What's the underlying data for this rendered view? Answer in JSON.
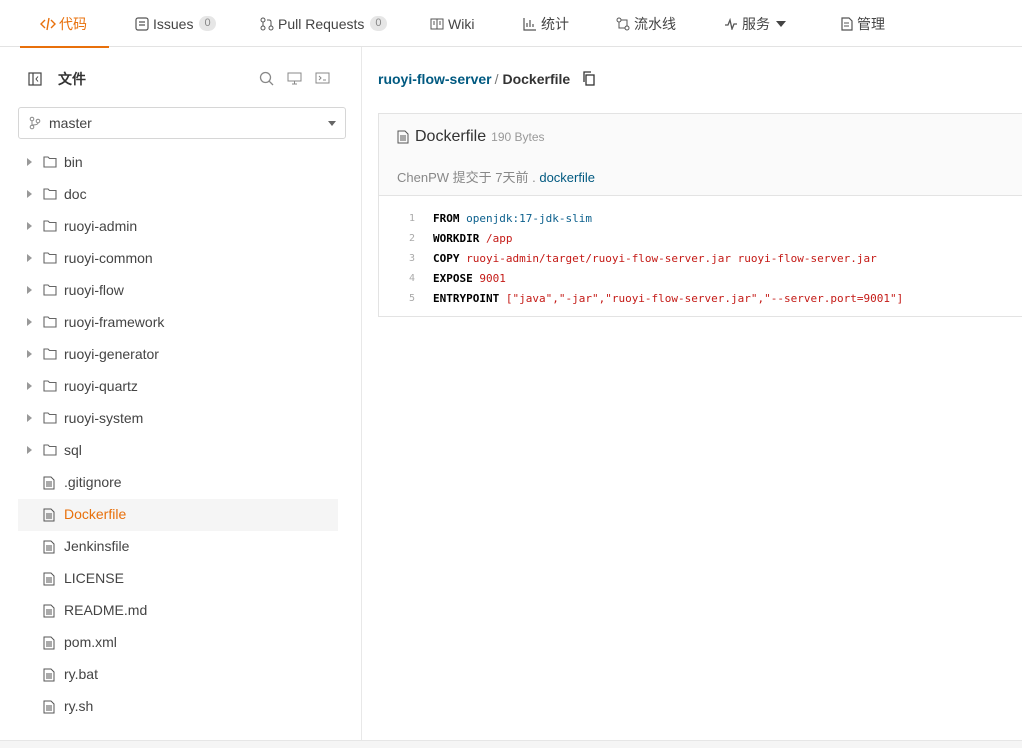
{
  "tabs": [
    {
      "label": "代码",
      "icon": "code-icon",
      "active": true
    },
    {
      "label": "Issues",
      "icon": "issues-icon",
      "badge": "0"
    },
    {
      "label": "Pull Requests",
      "icon": "pull-request-icon",
      "badge": "0"
    },
    {
      "label": "Wiki",
      "icon": "wiki-icon"
    },
    {
      "label": "统计",
      "icon": "stats-icon"
    },
    {
      "label": "流水线",
      "icon": "pipeline-icon"
    },
    {
      "label": "服务",
      "icon": "service-icon"
    },
    {
      "label": "管理",
      "icon": "manage-icon"
    }
  ],
  "sidebar": {
    "title": "文件",
    "branch": "master",
    "items": [
      {
        "label": "bin",
        "type": "folder"
      },
      {
        "label": "doc",
        "type": "folder"
      },
      {
        "label": "ruoyi-admin",
        "type": "folder"
      },
      {
        "label": "ruoyi-common",
        "type": "folder"
      },
      {
        "label": "ruoyi-flow",
        "type": "folder"
      },
      {
        "label": "ruoyi-framework",
        "type": "folder"
      },
      {
        "label": "ruoyi-generator",
        "type": "folder"
      },
      {
        "label": "ruoyi-quartz",
        "type": "folder"
      },
      {
        "label": "ruoyi-system",
        "type": "folder"
      },
      {
        "label": "sql",
        "type": "folder"
      },
      {
        "label": ".gitignore",
        "type": "file"
      },
      {
        "label": "Dockerfile",
        "type": "file",
        "selected": true
      },
      {
        "label": "Jenkinsfile",
        "type": "file"
      },
      {
        "label": "LICENSE",
        "type": "file"
      },
      {
        "label": "README.md",
        "type": "file"
      },
      {
        "label": "pom.xml",
        "type": "file"
      },
      {
        "label": "ry.bat",
        "type": "file"
      },
      {
        "label": "ry.sh",
        "type": "file"
      }
    ]
  },
  "breadcrumb": {
    "repo": "ruoyi-flow-server",
    "separator": "/",
    "file": "Dockerfile"
  },
  "file": {
    "name": "Dockerfile",
    "size": "190 Bytes",
    "commit_author": "ChenPW",
    "commit_text": " 提交于 ",
    "commit_ago": "7天前",
    "commit_dot": " . ",
    "commit_message": "dockerfile",
    "lines": [
      {
        "n": "1",
        "kw": "FROM",
        "a": "openjdk:17-jdk-slim",
        "b": ""
      },
      {
        "n": "2",
        "kw": "WORKDIR",
        "a": "",
        "b": "/app"
      },
      {
        "n": "3",
        "kw": "COPY",
        "a": "",
        "b": "ruoyi-admin/target/ruoyi-flow-server.jar ruoyi-flow-server.jar"
      },
      {
        "n": "4",
        "kw": "EXPOSE",
        "a": "",
        "b": "9001"
      },
      {
        "n": "5",
        "kw": "ENTRYPOINT",
        "a": "",
        "b": "[\"java\",\"-jar\",\"ruoyi-flow-server.jar\",\"--server.port=9001\"]"
      }
    ]
  },
  "colors": {
    "accent": "#e8700b",
    "link": "#005980"
  }
}
